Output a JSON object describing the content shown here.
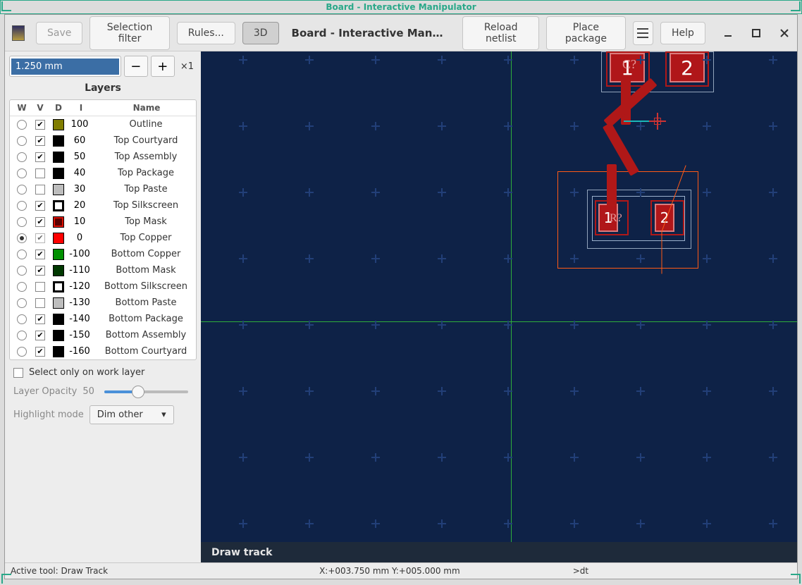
{
  "window": {
    "title": "Board - Interactive Manipulator"
  },
  "toolbar": {
    "save": "Save",
    "selection_filter": "Selection filter",
    "rules": "Rules...",
    "three_d": "3D",
    "title": "Board - Interactive Man…",
    "reload_netlist": "Reload netlist",
    "place_package": "Place package",
    "help": "Help"
  },
  "dimension": {
    "value": "1.250 mm",
    "multiplier": "×1"
  },
  "layers_panel": {
    "title": "Layers",
    "cols": {
      "w": "W",
      "v": "V",
      "d": "D",
      "i": "I",
      "name": "Name"
    },
    "rows": [
      {
        "w": false,
        "v": true,
        "color": "#807d00",
        "i": "100",
        "name": "Outline"
      },
      {
        "w": false,
        "v": true,
        "color": "#000000",
        "i": "60",
        "name": "Top Courtyard"
      },
      {
        "w": false,
        "v": true,
        "color": "#000000",
        "i": "50",
        "name": "Top Assembly"
      },
      {
        "w": false,
        "v": false,
        "color": "#000000",
        "i": "40",
        "name": "Top Package"
      },
      {
        "w": false,
        "v": false,
        "color": "#bdbdbd",
        "i": "30",
        "name": "Top Paste"
      },
      {
        "w": false,
        "v": true,
        "color": "#ffffff",
        "i": "20",
        "name": "Top Silkscreen",
        "outline_sw": true
      },
      {
        "w": false,
        "v": true,
        "color": "#5a0000",
        "i": "10",
        "name": "Top Mask",
        "inner_border": "#d10"
      },
      {
        "w": true,
        "v": true,
        "color": "#ff0000",
        "i": "0",
        "name": "Top Copper",
        "v_locked": true
      },
      {
        "w": false,
        "v": true,
        "color": "#009000",
        "i": "-100",
        "name": "Bottom Copper"
      },
      {
        "w": false,
        "v": true,
        "color": "#003800",
        "i": "-110",
        "name": "Bottom Mask"
      },
      {
        "w": false,
        "v": false,
        "color": "#ffffff",
        "i": "-120",
        "name": "Bottom Silkscreen",
        "outline_sw": true
      },
      {
        "w": false,
        "v": false,
        "color": "#bdbdbd",
        "i": "-130",
        "name": "Bottom Paste"
      },
      {
        "w": false,
        "v": true,
        "color": "#000000",
        "i": "-140",
        "name": "Bottom Package"
      },
      {
        "w": false,
        "v": true,
        "color": "#000000",
        "i": "-150",
        "name": "Bottom Assembly"
      },
      {
        "w": false,
        "v": true,
        "color": "#000000",
        "i": "-160",
        "name": "Bottom Courtyard"
      }
    ]
  },
  "options": {
    "select_only_label": "Select only on work layer",
    "opacity_label": "Layer Opacity",
    "opacity_value": "50",
    "highlight_mode_label": "Highlight mode",
    "highlight_mode_value": "Dim other"
  },
  "components": {
    "c_ref": "C?",
    "c_pad1": "1",
    "c_pad2": "2",
    "r_ref": "R?",
    "r_pad1": "1",
    "r_pad2": "2"
  },
  "info": {
    "mode": "Draw track"
  },
  "status": {
    "tool": "Active tool: Draw Track",
    "coords": "X:+003.750 mm Y:+005.000 mm",
    "cmd": ">dt"
  }
}
